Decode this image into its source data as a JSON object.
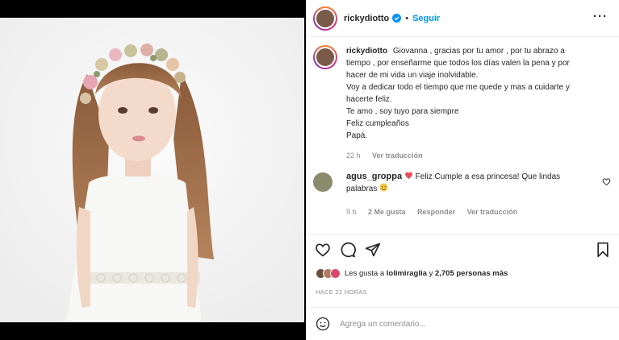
{
  "post": {
    "username": "rickydiotto",
    "follow_label": "Seguir",
    "separator": "•",
    "more_label": "···"
  },
  "caption": {
    "username": "rickydiotto",
    "lines": [
      "Giovanna , gracias por tu amor , por tu abrazo a",
      "tiempo , por enseñarme que todos los días valen la pena y por",
      "hacer de mi vida un viaje inolvidable.",
      "Voy a dedicar todo el tiempo que me quede y mas a cuidarte y",
      "hacerte feliz.",
      "Te amo , soy tuyo para siempre",
      "Feliz cumpleaños",
      "Papá."
    ],
    "time": "22 h",
    "see_translation": "Ver traducción"
  },
  "comment": {
    "username": "agus_groppa",
    "text_line1": "Feliz Cumple a esa princesa! Que lindas",
    "text_line2": "palabras",
    "time": "9 h",
    "likes": "2 Me gusta",
    "reply": "Responder",
    "see_translation": "Ver traducción"
  },
  "likes": {
    "prefix": "Les gusta a",
    "user": "lolimiraglia",
    "middle": "y",
    "count": "2,705 personas más"
  },
  "timestamp": "HACE 22 HORAS",
  "add_comment": {
    "placeholder": "Agrega un comentario..."
  },
  "icons": {
    "verified": "verified-badge-icon",
    "more": "more-options-icon",
    "like": "heart-icon",
    "comment": "comment-icon",
    "share": "send-icon",
    "save": "bookmark-icon",
    "emoji": "smile-icon",
    "comment_like": "heart-outline-icon"
  },
  "colors": {
    "accent": "#0095f6",
    "heart_red": "#ed4956",
    "muted": "#8e8e8e",
    "text": "#262626"
  }
}
